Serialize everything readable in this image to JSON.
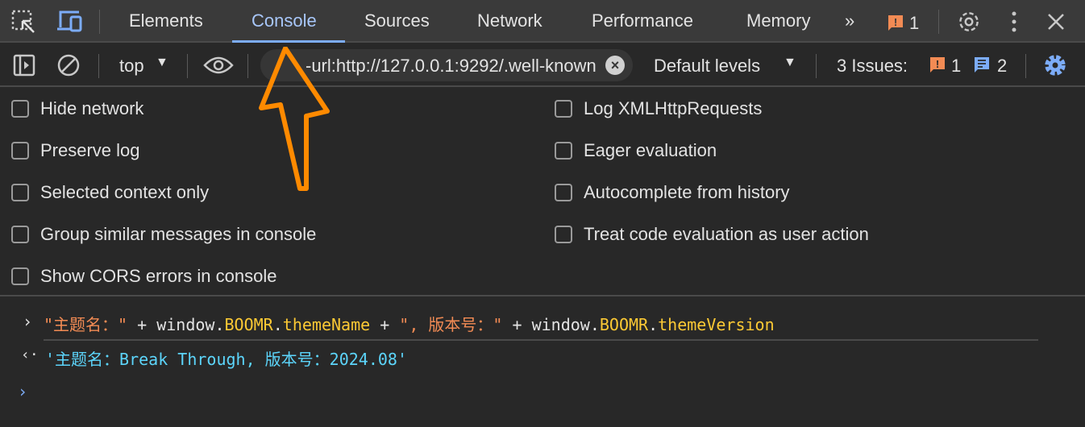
{
  "tabs": {
    "items": [
      {
        "label": "Elements"
      },
      {
        "label": "Console",
        "active": true
      },
      {
        "label": "Sources"
      },
      {
        "label": "Network"
      },
      {
        "label": "Performance"
      },
      {
        "label": "Memory"
      }
    ],
    "issue_count": "1"
  },
  "toolbar": {
    "context": "top",
    "filter_value": "-url:http://127.0.0.1:9292/.well-known",
    "levels": "Default levels",
    "issues_label": "3 Issues:",
    "issues_error": "1",
    "issues_info": "2"
  },
  "settings": {
    "left": [
      {
        "label": "Hide network",
        "checked": false
      },
      {
        "label": "Preserve log",
        "checked": false
      },
      {
        "label": "Selected context only",
        "checked": false
      },
      {
        "label": "Group similar messages in console",
        "checked": false
      },
      {
        "label": "Show CORS errors in console",
        "checked": false
      }
    ],
    "right": [
      {
        "label": "Log XMLHttpRequests",
        "checked": false
      },
      {
        "label": "Eager evaluation",
        "checked": false
      },
      {
        "label": "Autocomplete from history",
        "checked": false
      },
      {
        "label": "Treat code evaluation as user action",
        "checked": false
      }
    ]
  },
  "console": {
    "input": {
      "s1": "\"主题名：\"",
      "p1": " + window.",
      "k1": "BOOMR",
      "p2": ".",
      "k2": "themeName",
      "p3": " + ",
      "s2": "\", 版本号：\"",
      "p4": " + window.",
      "k3": "BOOMR",
      "p5": ".",
      "k4": "themeVersion"
    },
    "result": "'主题名：Break Through, 版本号：2024.08'"
  },
  "colors": {
    "accent": "#7cacf8",
    "string": "#f28b54",
    "keyword": "#fcc934",
    "result": "#5cd5fb",
    "annotation_arrow": "#ff8a00"
  }
}
